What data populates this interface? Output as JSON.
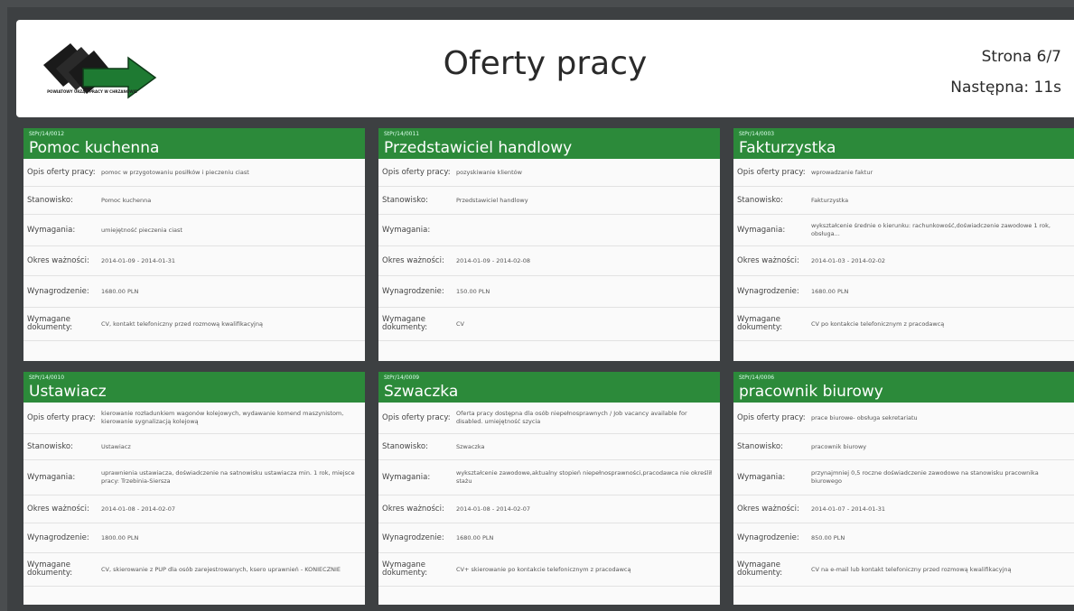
{
  "header": {
    "logo_text": "POWIATOWY URZĄD PRACY W CHRZANOWIE",
    "title": "Oferty pracy",
    "page": "Strona 6/7",
    "next": "Następna: 11s"
  },
  "labels": {
    "opis": "Opis oferty pracy:",
    "stanowisko": "Stanowisko:",
    "wymagania": "Wymagania:",
    "okres": "Okres ważności:",
    "wynagrodzenie": "Wynagrodzenie:",
    "dokumenty": "Wymagane dokumenty:"
  },
  "cards": [
    {
      "code": "StPr/14/0012",
      "title": "Pomoc kuchenna",
      "opis": "pomoc w przygotowaniu posiłków i pieczeniu ciast",
      "stanowisko": "Pomoc kuchenna",
      "wymagania": "umiejętność pieczenia ciast",
      "okres": "2014-01-09 - 2014-01-31",
      "wynagrodzenie": "1680.00 PLN",
      "dokumenty": "CV, kontakt telefoniczny przed rozmową kwalifikacyjną"
    },
    {
      "code": "StPr/14/0011",
      "title": "Przedstawiciel handlowy",
      "opis": "pozyskiwanie klientów",
      "stanowisko": "Przedstawiciel handlowy",
      "wymagania": "",
      "okres": "2014-01-09 - 2014-02-08",
      "wynagrodzenie": "150.00 PLN",
      "dokumenty": "CV"
    },
    {
      "code": "StPr/14/0003",
      "title": "Fakturzystka",
      "opis": "wprowadzanie faktur",
      "stanowisko": "Fakturzystka",
      "wymagania": "wykształcenie średnie o kierunku: rachunkowość,doświadczenie zawodowe 1 rok, obsługa...",
      "okres": "2014-01-03 - 2014-02-02",
      "wynagrodzenie": "1680.00 PLN",
      "dokumenty": "CV po kontakcie telefonicznym z pracodawcą"
    },
    {
      "code": "StPr/14/0010",
      "title": "Ustawiacz",
      "opis": "kierowanie rozładunkiem wagonów kolejowych, wydawanie komend maszynistom, kierowanie sygnalizacją kolejową",
      "stanowisko": "Ustawiacz",
      "wymagania": "uprawnienia ustawiacza, doświadczenie na satnowisku ustawiacza min. 1 rok, miejsce pracy: Trzebinia-Siersza",
      "okres": "2014-01-08 - 2014-02-07",
      "wynagrodzenie": "1800.00 PLN",
      "dokumenty": "CV, skierowanie z PUP dla osób zarejestrowanych, ksero uprawnień - KONIECZNIE"
    },
    {
      "code": "StPr/14/0009",
      "title": "Szwaczka",
      "opis": "Oferta pracy dostępna dla osób niepełnosprawnych / Job vacancy available for disabled. umiejętność szycia",
      "stanowisko": "Szwaczka",
      "wymagania": "wykształcenie zawodowe,aktualny stopień niepełnosprawności,pracodawca nie określił stażu",
      "okres": "2014-01-08 - 2014-02-07",
      "wynagrodzenie": "1680.00 PLN",
      "dokumenty": "CV+ skierowanie po kontakcie telefonicznym z pracodawcą"
    },
    {
      "code": "StPr/14/0006",
      "title": "pracownik biurowy",
      "opis": "prace biurowe- obsługa sekretariatu",
      "stanowisko": "pracownik biurowy",
      "wymagania": "przynajmniej 0,5 roczne doświadczenie zawodowe na stanowisku pracownika biurowego",
      "okres": "2014-01-07 - 2014-01-31",
      "wynagrodzenie": "850.00 PLN",
      "dokumenty": "CV na e-mail lub kontakt telefoniczny przed rozmową kwalifikacyjną"
    }
  ]
}
